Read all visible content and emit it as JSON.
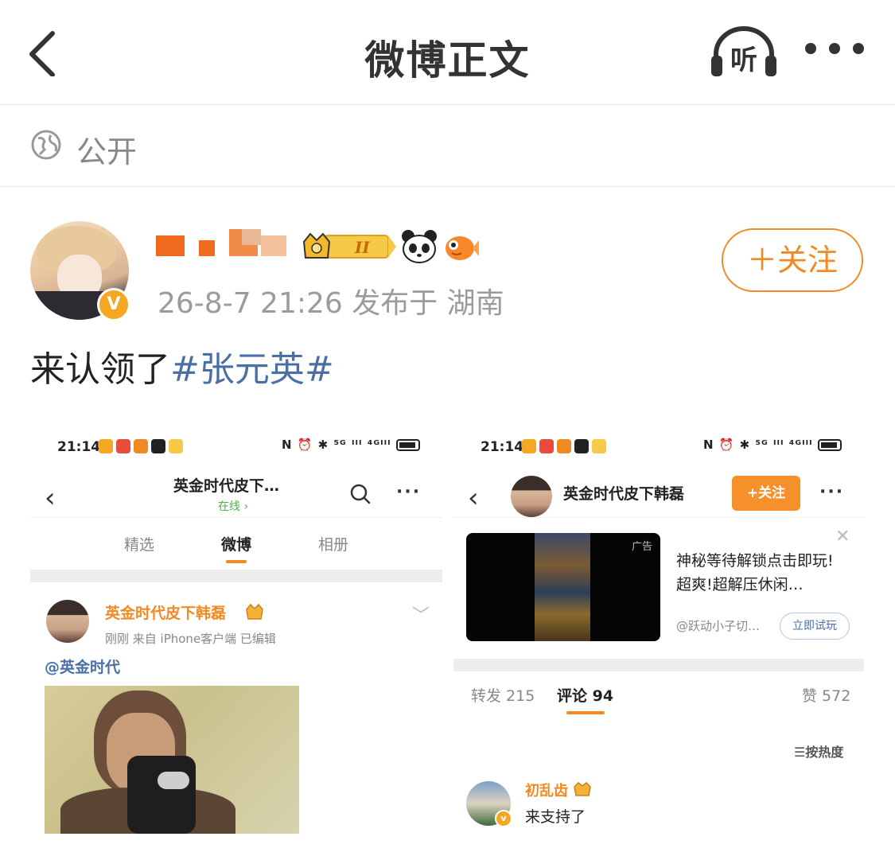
{
  "nav": {
    "title": "微博正文",
    "listen_label": "听"
  },
  "visibility": {
    "label": "公开"
  },
  "post": {
    "meta": "26-8-7 21:26  发布于 湖南",
    "follow_label": "＋关注",
    "text_prefix": "来认领了",
    "hashtag": "#张元英#"
  },
  "left_shot": {
    "status_time": "21:14",
    "status_right": "N ⏰ ✱ ⁵ᴳ ᴵᴵᴵ ⁴ᴳᴵᴵᴵ",
    "header_title": "英金时代皮下…",
    "header_sub": "在线 ›",
    "tabs": [
      {
        "label": "精选"
      },
      {
        "label": "微博"
      },
      {
        "label": "相册"
      }
    ],
    "author_name": "英金时代皮下韩磊",
    "author_meta": "刚刚  来自 iPhone客户端  已编辑",
    "mention": "@英金时代"
  },
  "right_shot": {
    "status_time": "21:14",
    "status_right": "N ⏰ ✱ ⁵ᴳ ᴵᴵᴵ ⁴ᴳᴵᴵᴵ",
    "header_title": "英金时代皮下韩磊",
    "follow_label": "+关注",
    "ad_tag": "广告",
    "ad_text": "神秘等待解锁点击即玩!超爽!超解压休闲…",
    "ad_source": "@跃动小子切…",
    "ad_button": "立即试玩",
    "stats": [
      {
        "label": "转发 215"
      },
      {
        "label": "评论 94"
      },
      {
        "label": "赞 572"
      }
    ],
    "sort_label": "☰按热度",
    "comment_name": "初乱齿",
    "comment_text": "来支持了"
  },
  "colors": {
    "accent": "#f08a24",
    "link": "#4a6fa5",
    "gray_text": "#9b9b9b"
  }
}
